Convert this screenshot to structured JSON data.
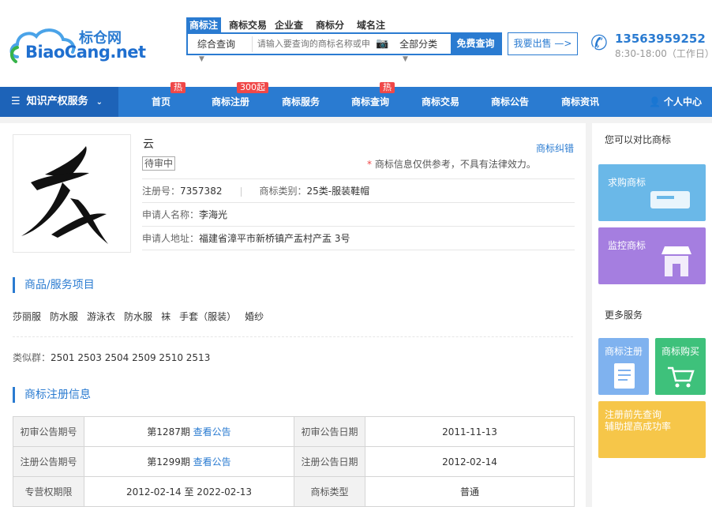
{
  "logo": {
    "cn": "标仓网",
    "en": "BiaoCang.net"
  },
  "search": {
    "tabs": [
      "商标注",
      "商标交易",
      "企业查",
      "商标分",
      "域名注"
    ],
    "scope": "综合查询",
    "placeholder": "请输入要查询的商标名称或申",
    "category": "全部分类",
    "button": "免费查询"
  },
  "sell_button": "我要出售 —>",
  "contact": {
    "phone": "13563959252",
    "hours": "8:30-18:00（工作日）"
  },
  "nav": {
    "category": "知识产权服务",
    "items": [
      {
        "label": "首页",
        "badge": "热"
      },
      {
        "label": "商标注册",
        "badge": "300起"
      },
      {
        "label": "商标服务",
        "badge": ""
      },
      {
        "label": "商标查询",
        "badge": "热"
      },
      {
        "label": "商标交易",
        "badge": ""
      },
      {
        "label": "商标公告",
        "badge": ""
      },
      {
        "label": "商标资讯",
        "badge": ""
      }
    ],
    "user": "个人中心"
  },
  "trademark": {
    "name": "云",
    "status": "待审中",
    "fix_link": "商标纠错",
    "note_star": "*",
    "note": "商标信息仅供参考，不具有法律效力。",
    "reg_no_label": "注册号：",
    "reg_no": "7357382",
    "class_label": "商标类别：",
    "class": "25类-服装鞋帽",
    "applicant_label": "申请人名称：",
    "applicant": "李海光",
    "address_label": "申请人地址：",
    "address": "福建省漳平市新桥镇产盂村产盂 3号"
  },
  "goods": {
    "title": "商品/服务项目",
    "items": [
      "莎丽服",
      "防水服",
      "游泳衣",
      "防水服",
      "袜",
      "手套（服装）",
      "婚纱"
    ],
    "similar_label": "类似群：",
    "similar": "2501 2503 2504 2509 2510 2513"
  },
  "registration": {
    "title": "商标注册信息",
    "rows": [
      {
        "h1": "初审公告期号",
        "v1": "第1287期",
        "link": "查看公告",
        "h2": "初审公告日期",
        "v2": "2011-11-13"
      },
      {
        "h1": "注册公告期号",
        "v1": "第1299期",
        "link": "查看公告",
        "h2": "注册公告日期",
        "v2": "2012-02-14"
      },
      {
        "h1": "专营权期限",
        "v1": "2012-02-14 至 2022-02-13",
        "link": "",
        "h2": "商标类型",
        "v2": "普通"
      }
    ]
  },
  "side": {
    "compare_title": "您可以对比商标",
    "buy": "求购商标",
    "monitor": "监控商标",
    "more_title": "更多服务",
    "reg": "商标注册",
    "purchase": "商标购买",
    "query": "注册前先查询\n辅助提高成功率"
  },
  "colors": {
    "primary": "#2a7bd1",
    "badge": "#f04848"
  }
}
